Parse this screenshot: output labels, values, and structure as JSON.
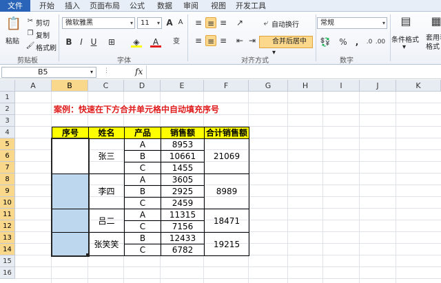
{
  "tabs": [
    "文件",
    "开始",
    "插入",
    "页面布局",
    "公式",
    "数据",
    "审阅",
    "视图",
    "开发工具"
  ],
  "clipboard": {
    "paste": "粘贴",
    "cut": "剪切",
    "copy": "复制",
    "format_painter": "格式刷",
    "label": "剪贴板"
  },
  "font": {
    "name": "微软雅黑",
    "size": "11",
    "label": "字体",
    "bold": "B",
    "italic": "I",
    "underline": "U",
    "grow": "A",
    "shrink": "A",
    "fill_color": "#ffff00",
    "font_color": "#e01b1b"
  },
  "align": {
    "label": "对齐方式",
    "wrap": "自动换行",
    "merge": "合并后居中"
  },
  "number": {
    "format": "常规",
    "label": "数字",
    "percent": "%",
    "comma": ","
  },
  "styles": {
    "cond": "条件格式",
    "table": "套用表格格式"
  },
  "formula": {
    "namebox": "B5",
    "fx": "fx",
    "value": ""
  },
  "columns": [
    "A",
    "B",
    "C",
    "D",
    "E",
    "F",
    "G",
    "H",
    "I",
    "J",
    "K"
  ],
  "rows": [
    "1",
    "2",
    "3",
    "4",
    "5",
    "6",
    "7",
    "8",
    "9",
    "10",
    "11",
    "12",
    "13",
    "14",
    "15",
    "16"
  ],
  "sheet": {
    "title": "案例：快速在下方合并单元格中自动填充序号",
    "headers": [
      "序号",
      "姓名",
      "产品",
      "销售额",
      "合计销售额"
    ],
    "names": [
      "张三",
      "李四",
      "吕二",
      "张笑笑"
    ],
    "products": [
      "A",
      "B",
      "C",
      "A",
      "B",
      "C",
      "A",
      "C",
      "B",
      "C"
    ],
    "sales": [
      "8953",
      "10661",
      "1455",
      "3605",
      "2925",
      "2459",
      "11315",
      "7156",
      "12433",
      "6782"
    ],
    "totals": [
      "21069",
      "8989",
      "18471",
      "19215"
    ]
  },
  "colors": {
    "header_fill": "#ffff00",
    "selection": "#bdd7ee",
    "title": "#e01b1b"
  }
}
